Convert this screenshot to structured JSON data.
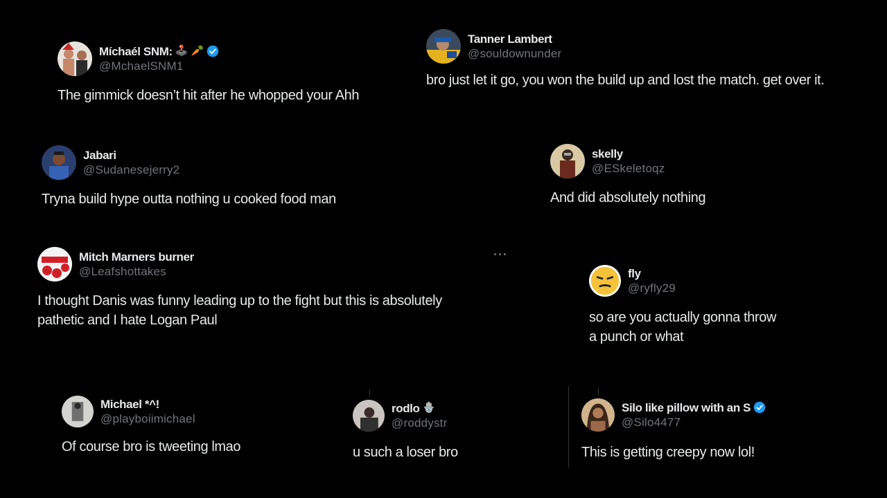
{
  "colors": {
    "background": "#000000",
    "text": "#e7e9ea",
    "muted": "#71767b",
    "verified": "#1d9bf0"
  },
  "tweets": [
    {
      "name": "Míchaél SNM:",
      "emoji": "🕹️ 🥕",
      "verified": true,
      "handle": "@MchaelSNM1",
      "text": "The gimmick doesn’t hit after he whopped your Ahh"
    },
    {
      "name": "Tanner Lambert",
      "emoji": "",
      "verified": false,
      "handle": "@souldownunder",
      "text": "bro just let it go, you won the build up and lost the match. get over it."
    },
    {
      "name": "Jabari",
      "emoji": "",
      "verified": false,
      "handle": "@Sudanesejerry2",
      "text": "Tryna build hype outta nothing u cooked food man"
    },
    {
      "name": "skelly",
      "emoji": "",
      "verified": false,
      "handle": "@ESkeletoqz",
      "text": "And did absolutely nothing"
    },
    {
      "name": "Mitch Marners burner",
      "emoji": "",
      "verified": false,
      "handle": "@Leafshottakes",
      "text_lines": [
        "I thought Danis was funny leading up to the fight but this is absolutely",
        "pathetic and I hate Logan Paul"
      ],
      "more": "···"
    },
    {
      "name": "fly",
      "emoji": "",
      "verified": false,
      "handle": "@ryfly29",
      "text_lines": [
        "so are you actually gonna throw",
        "a punch or what"
      ]
    },
    {
      "name": "Michael *^!",
      "emoji": "",
      "verified": false,
      "handle": "@playboiimichael",
      "text": "Of course bro is tweeting lmao"
    },
    {
      "name": "rodlo",
      "emoji": "🪬",
      "verified": false,
      "handle": "@roddystr",
      "text": "u such a loser bro"
    },
    {
      "name": "Silo like pillow with an S",
      "emoji": "",
      "verified": true,
      "handle": "@Silo4477",
      "text": "This is getting creepy now lol!"
    }
  ]
}
